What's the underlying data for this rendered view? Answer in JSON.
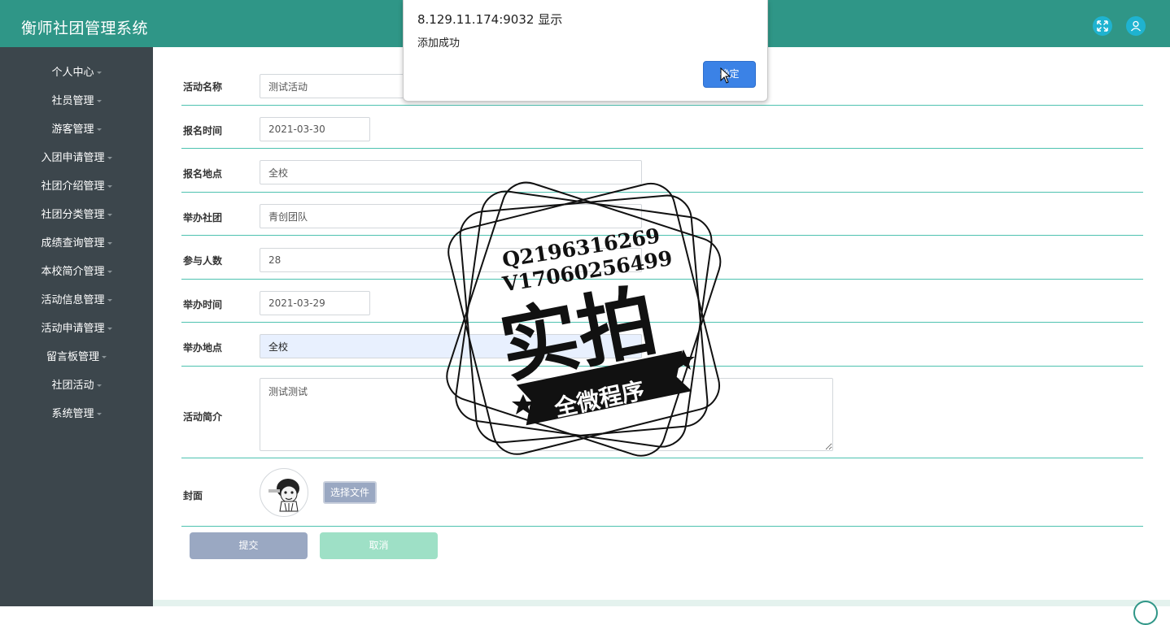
{
  "app": {
    "title": "衡师社团管理系统"
  },
  "header": {
    "icons": [
      "fullscreen-icon",
      "user-icon"
    ]
  },
  "sidebar": {
    "items": [
      {
        "label": "个人中心"
      },
      {
        "label": "社员管理"
      },
      {
        "label": "游客管理"
      },
      {
        "label": "入团申请管理"
      },
      {
        "label": "社团介绍管理"
      },
      {
        "label": "社团分类管理"
      },
      {
        "label": "成绩查询管理"
      },
      {
        "label": "本校简介管理"
      },
      {
        "label": "活动信息管理"
      },
      {
        "label": "活动申请管理"
      },
      {
        "label": "留言板管理"
      },
      {
        "label": "社团活动"
      },
      {
        "label": "系统管理"
      }
    ]
  },
  "form": {
    "activity_name": {
      "label": "活动名称",
      "value": "测试活动"
    },
    "signup_time": {
      "label": "报名时间",
      "value": "2021-03-30"
    },
    "signup_place": {
      "label": "报名地点",
      "value": "全校"
    },
    "host_club": {
      "label": "举办社团",
      "value": "青创团队"
    },
    "participants": {
      "label": "参与人数",
      "value": "28"
    },
    "host_time": {
      "label": "举办时间",
      "value": "2021-03-29"
    },
    "host_place": {
      "label": "举办地点",
      "value": "全校"
    },
    "intro": {
      "label": "活动简介",
      "value": "测试测试"
    },
    "cover": {
      "label": "封面",
      "choose_label": "选择文件"
    },
    "submit_label": "提交",
    "cancel_label": "取消"
  },
  "dialog": {
    "origin": "8.129.11.174:9032 显示",
    "message": "添加成功",
    "ok_label": "确定"
  },
  "watermark": {
    "line1": "Q2196316269",
    "line2": "V17060256499",
    "main": "实拍",
    "ribbon": "全微程序"
  },
  "colors": {
    "header_bg": "#2f9687",
    "sidebar_bg": "#3c464c",
    "row_divider": "#4ec2b0",
    "dialog_ok": "#3b82e6",
    "submit_bg": "#9aa8c2",
    "cancel_bg": "#9ee0c6"
  }
}
